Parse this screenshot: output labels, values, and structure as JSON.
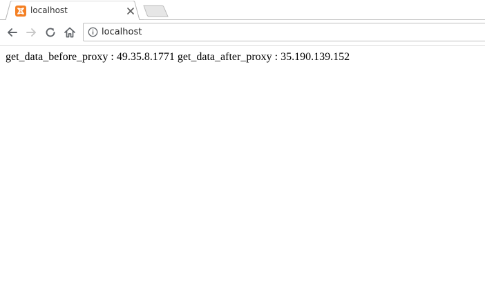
{
  "browser": {
    "tab": {
      "title": "localhost",
      "favicon": "xampp-icon",
      "favicon_color": "#f48024"
    },
    "new_tab_icon": "new-tab-icon",
    "toolbar": {
      "back_icon": "back-arrow-icon",
      "forward_icon": "forward-arrow-icon",
      "reload_icon": "reload-icon",
      "home_icon": "home-icon",
      "site_info_icon": "info-icon",
      "address": "localhost"
    }
  },
  "page": {
    "text": "get_data_before_proxy : 49.35.8.1771 get_data_after_proxy : 35.190.139.152"
  }
}
